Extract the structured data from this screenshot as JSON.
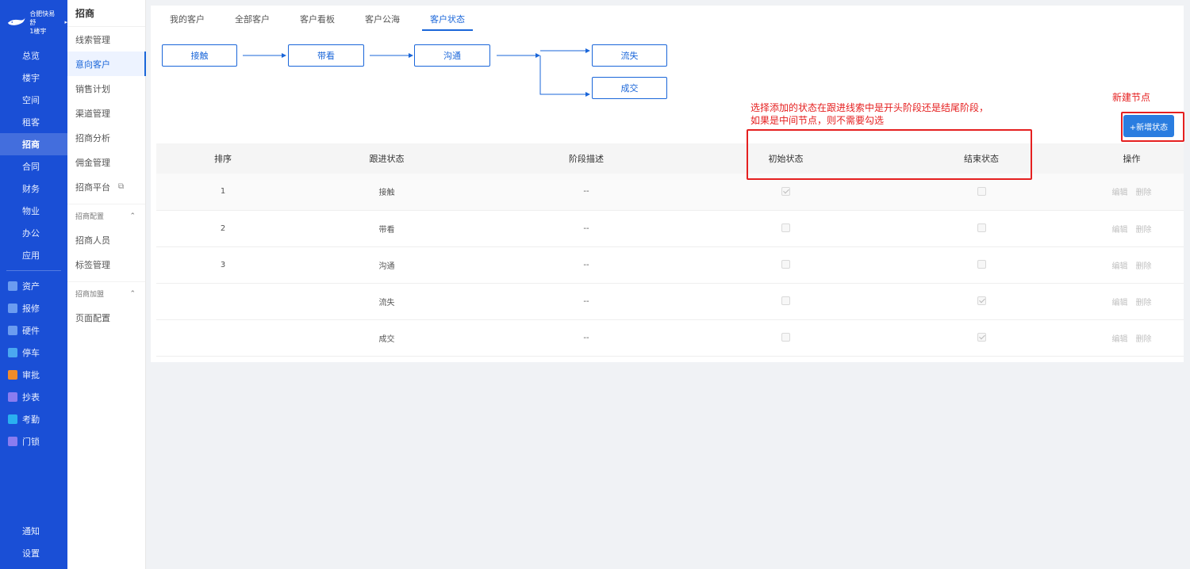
{
  "brand": {
    "line1": "合肥快易舒",
    "line2": "1楼宇"
  },
  "left_nav": {
    "primary": [
      {
        "label": "总览",
        "icon": "dashboard-icon"
      },
      {
        "label": "楼宇",
        "icon": "building-icon"
      },
      {
        "label": "空间",
        "icon": "cube-icon"
      },
      {
        "label": "租客",
        "icon": "people-icon"
      },
      {
        "label": "招商",
        "icon": "tag-icon"
      },
      {
        "label": "合同",
        "icon": "document-icon"
      },
      {
        "label": "财务",
        "icon": "coin-icon"
      },
      {
        "label": "物业",
        "icon": "home-icon"
      },
      {
        "label": "办公",
        "icon": "monitor-icon"
      },
      {
        "label": "应用",
        "icon": "apps-icon"
      }
    ],
    "apps": [
      {
        "label": "资产",
        "color": "#6b9cf0"
      },
      {
        "label": "报修",
        "color": "#6b9cf0"
      },
      {
        "label": "硬件",
        "color": "#6b9cf0"
      },
      {
        "label": "停车",
        "color": "#4aa8f0"
      },
      {
        "label": "审批",
        "color": "#f08c2a"
      },
      {
        "label": "抄表",
        "color": "#8a7cf0"
      },
      {
        "label": "考勤",
        "color": "#2ab0f0"
      },
      {
        "label": "门锁",
        "color": "#8a7cf0"
      }
    ],
    "bottom": [
      {
        "label": "通知",
        "icon": "bell-icon"
      },
      {
        "label": "设置",
        "icon": "menu-icon"
      }
    ]
  },
  "sub_nav": {
    "title": "招商",
    "items": [
      "线索管理",
      "意向客户",
      "销售计划",
      "渠道管理",
      "招商分析",
      "佣金管理",
      "招商平台"
    ],
    "group1": {
      "label": "招商配置",
      "items": [
        "招商人员",
        "标签管理"
      ]
    },
    "group2": {
      "label": "招商加盟",
      "items": [
        "页面配置"
      ]
    }
  },
  "tabs": [
    "我的客户",
    "全部客户",
    "客户看板",
    "客户公海",
    "客户状态"
  ],
  "flow": {
    "nodes": [
      "接触",
      "带看",
      "沟通",
      "流失",
      "成交"
    ]
  },
  "add_button": "+新增状态",
  "table": {
    "headers": [
      "排序",
      "跟进状态",
      "阶段描述",
      "初始状态",
      "结束状态",
      "操作"
    ],
    "rows": [
      {
        "order": "1",
        "status": "接触",
        "desc": "--",
        "initial": true,
        "final": false
      },
      {
        "order": "2",
        "status": "带看",
        "desc": "--",
        "initial": false,
        "final": false
      },
      {
        "order": "3",
        "status": "沟通",
        "desc": "--",
        "initial": false,
        "final": false
      },
      {
        "order": "",
        "status": "流失",
        "desc": "--",
        "initial": false,
        "final": true
      },
      {
        "order": "",
        "status": "成交",
        "desc": "--",
        "initial": false,
        "final": true
      }
    ],
    "ops": {
      "edit": "编辑",
      "delete": "删除"
    }
  },
  "annotations": {
    "note_line1": "选择添加的状态在跟进线索中是开头阶段还是结尾阶段，",
    "note_line2": "如果是中间节点，则不需要勾选",
    "new_node": "新建节点"
  }
}
